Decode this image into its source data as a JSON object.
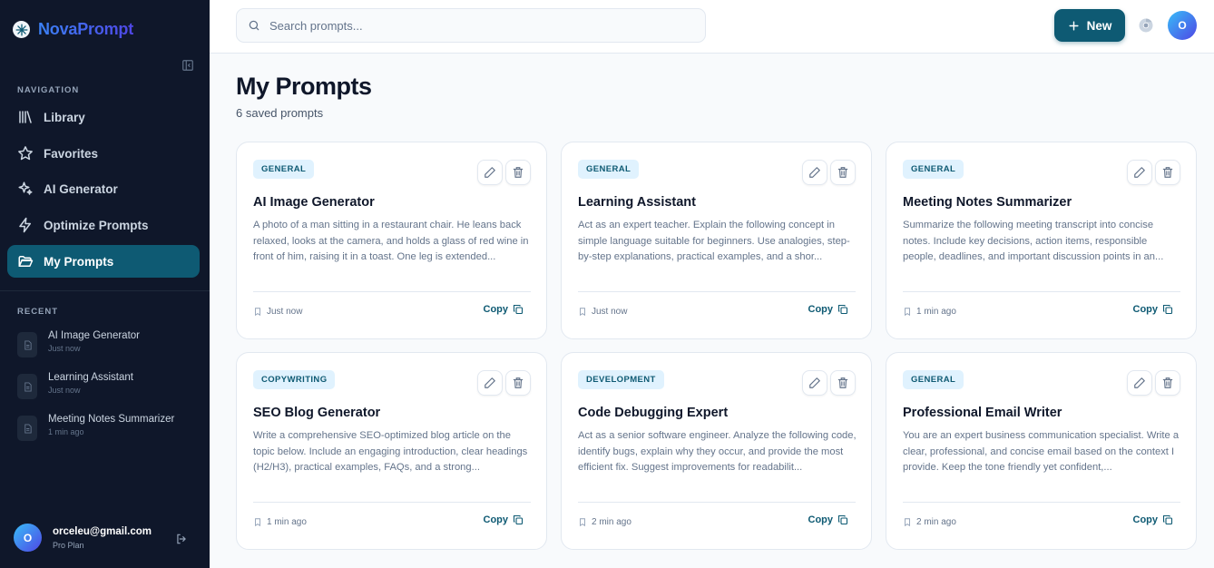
{
  "app": {
    "brand": "NovaPrompt"
  },
  "sidebar": {
    "nav_label": "NAVIGATION",
    "items": [
      {
        "label": "Library",
        "icon": "library-icon",
        "active": false
      },
      {
        "label": "Favorites",
        "icon": "star-icon",
        "active": false
      },
      {
        "label": "AI Generator",
        "icon": "sparkles-icon",
        "active": false
      },
      {
        "label": "Optimize Prompts",
        "icon": "bolt-icon",
        "active": false
      },
      {
        "label": "My Prompts",
        "icon": "folder-open-icon",
        "active": true
      }
    ],
    "recent_label": "RECENT",
    "recent": [
      {
        "title": "AI Image Generator",
        "time": "Just now"
      },
      {
        "title": "Learning Assistant",
        "time": "Just now"
      },
      {
        "title": "Meeting Notes Summarizer",
        "time": "1 min ago"
      }
    ],
    "user": {
      "initial": "O",
      "email": "orceleu@gmail.com",
      "plan": "Pro Plan"
    }
  },
  "topbar": {
    "search_placeholder": "Search prompts...",
    "new_label": "New",
    "avatar_initial": "O"
  },
  "main": {
    "title": "My Prompts",
    "subtitle": "6 saved prompts",
    "copy_label": "Copy",
    "cards": [
      {
        "tag": "GENERAL",
        "title": "AI Image Generator",
        "desc": "A photo of a man sitting in a restaurant chair. He leans back relaxed, looks at the camera, and holds a glass of red wine in front of him, raising it in a toast. One leg is extended...",
        "time": "Just now"
      },
      {
        "tag": "GENERAL",
        "title": "Learning Assistant",
        "desc": "Act as an expert teacher. Explain the following concept in simple language suitable for beginners. Use analogies, step-by-step explanations, practical examples, and a shor...",
        "time": "Just now"
      },
      {
        "tag": "GENERAL",
        "title": "Meeting Notes Summarizer",
        "desc": "Summarize the following meeting transcript into concise notes. Include key decisions, action items, responsible people, deadlines, and important discussion points in an...",
        "time": "1 min ago"
      },
      {
        "tag": "COPYWRITING",
        "title": "SEO Blog Generator",
        "desc": "Write a comprehensive SEO-optimized blog article on the topic below. Include an engaging introduction, clear headings (H2/H3), practical examples, FAQs, and a strong...",
        "time": "1 min ago"
      },
      {
        "tag": "DEVELOPMENT",
        "title": "Code Debugging Expert",
        "desc": "Act as a senior software engineer. Analyze the following code, identify bugs, explain why they occur, and provide the most efficient fix. Suggest improvements for readabilit...",
        "time": "2 min ago"
      },
      {
        "tag": "GENERAL",
        "title": "Professional Email Writer",
        "desc": "You are an expert business communication specialist. Write a clear, professional, and concise email based on the context I provide. Keep the tone friendly yet confident,...",
        "time": "2 min ago"
      }
    ]
  },
  "colors": {
    "sidebar_bg": "#0f172a",
    "accent": "#0e5a73",
    "tag_bg": "#e0f2fe"
  }
}
